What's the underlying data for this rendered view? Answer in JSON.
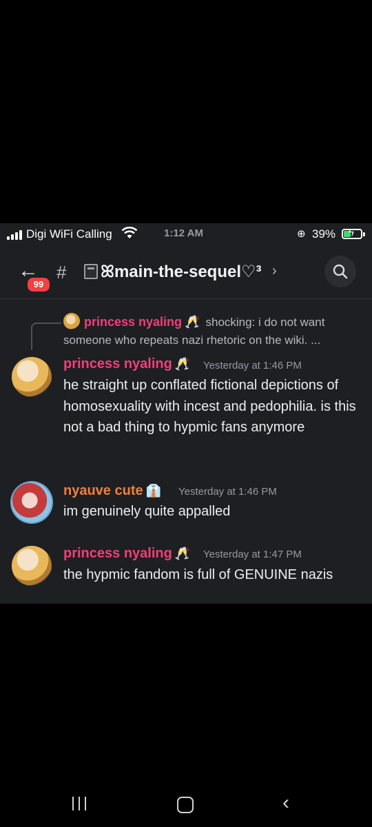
{
  "status_bar": {
    "carrier": "Digi WiFi Calling",
    "time": "1:12 AM",
    "battery_percent": "39%"
  },
  "header": {
    "unread_badge": "99",
    "channel_prefix": "#",
    "channel_name": "ꕤmain-the-sequel♡³",
    "chevron": "›"
  },
  "reply_preview": {
    "author": "princess nyaling",
    "author_emoji": "🥂",
    "text": "shocking: i do not want someone who repeats nazi rhetoric on the wiki. ..."
  },
  "messages": [
    {
      "author": "princess nyaling",
      "author_emoji": "🥂",
      "timestamp": "Yesterday at 1:46 PM",
      "text": "he straight up conflated fictional depictions of homosexuality with incest and pedophilia. is this not a bad thing to hypmic fans anymore"
    },
    {
      "author": "nyauve cute",
      "author_emoji": "👔",
      "timestamp": "Yesterday at 1:46 PM",
      "text": "im genuinely quite appalled"
    },
    {
      "author": "princess nyaling",
      "author_emoji": "🥂",
      "timestamp": "Yesterday at 1:47 PM",
      "text": "the hypmic fandom is full of GENUINE nazis"
    }
  ],
  "colors": {
    "background": "#1e1f22",
    "princess_name": "#f23f7a",
    "nyauve_name": "#f0803c",
    "badge": "#f23f43"
  }
}
